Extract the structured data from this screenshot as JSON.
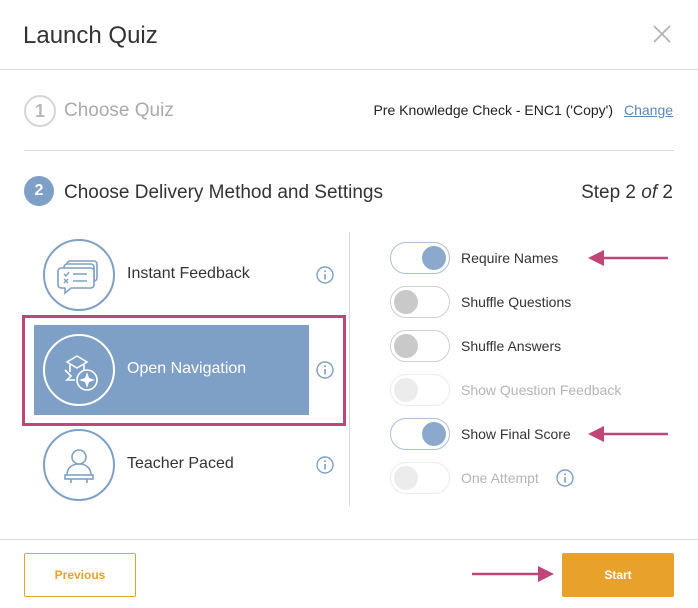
{
  "modal": {
    "title": "Launch Quiz"
  },
  "step1": {
    "number": "1",
    "label": "Choose Quiz",
    "quiz_name": "Pre Knowledge Check - ENC1 ('Copy')",
    "change_label": "Change"
  },
  "step2": {
    "number": "2",
    "label": "Choose Delivery Method and Settings",
    "step_prefix": "Step 2 ",
    "step_of": "of",
    "step_suffix": " 2"
  },
  "methods": [
    {
      "label": "Instant Feedback",
      "icon": "instant-feedback-icon",
      "selected": false
    },
    {
      "label": "Open Navigation",
      "icon": "open-navigation-icon",
      "selected": true
    },
    {
      "label": "Teacher Paced",
      "icon": "teacher-paced-icon",
      "selected": false
    }
  ],
  "settings": [
    {
      "label": "Require Names",
      "state": "on"
    },
    {
      "label": "Shuffle Questions",
      "state": "off"
    },
    {
      "label": "Shuffle Answers",
      "state": "off"
    },
    {
      "label": "Show Question Feedback",
      "state": "disabled"
    },
    {
      "label": "Show Final Score",
      "state": "on"
    },
    {
      "label": "One Attempt",
      "state": "disabled"
    }
  ],
  "footer": {
    "previous_label": "Previous",
    "start_label": "Start"
  },
  "colors": {
    "accent_blue": "#7fa0c6",
    "toggle_on": "#8ba9cd",
    "button_orange": "#e8a22c",
    "annotation_pink": "#c0467a"
  }
}
